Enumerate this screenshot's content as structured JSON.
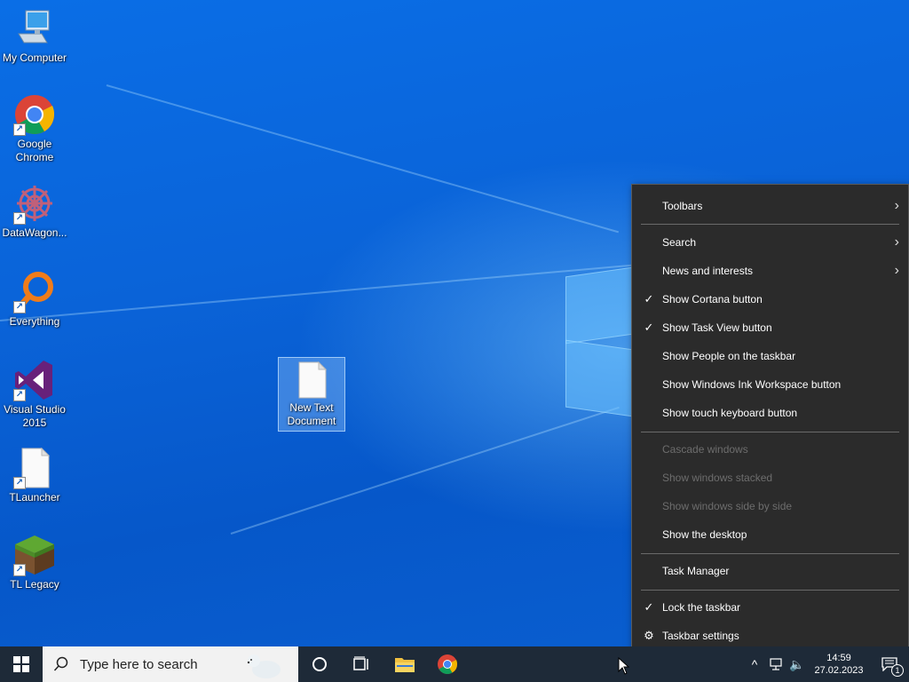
{
  "desktop": {
    "icons": [
      {
        "label": "My Computer",
        "icon": "computer-icon"
      },
      {
        "label": "Google Chrome",
        "icon": "chrome-icon"
      },
      {
        "label": "DataWagon...",
        "icon": "datawagon-icon"
      },
      {
        "label": "Everything",
        "icon": "everything-icon"
      },
      {
        "label": "Visual Studio 2015",
        "icon": "visual-studio-icon"
      },
      {
        "label": "TLauncher",
        "icon": "file-icon"
      },
      {
        "label": "TL Legacy",
        "icon": "minecraft-icon"
      },
      {
        "label": "New Text Document",
        "icon": "text-document-icon"
      }
    ]
  },
  "context_menu": {
    "items": [
      {
        "label": "Toolbars",
        "submenu": true
      },
      {
        "label": "Search",
        "submenu": true
      },
      {
        "label": "News and interests",
        "submenu": true
      },
      {
        "label": "Show Cortana button",
        "checked": true
      },
      {
        "label": "Show Task View button",
        "checked": true
      },
      {
        "label": "Show People on the taskbar"
      },
      {
        "label": "Show Windows Ink Workspace button"
      },
      {
        "label": "Show touch keyboard button"
      },
      {
        "label": "Cascade windows",
        "disabled": true
      },
      {
        "label": "Show windows stacked",
        "disabled": true
      },
      {
        "label": "Show windows side by side",
        "disabled": true
      },
      {
        "label": "Show the desktop"
      },
      {
        "label": "Task Manager"
      },
      {
        "label": "Lock the taskbar",
        "checked": true
      },
      {
        "label": "Taskbar settings",
        "icon": "gear-icon"
      }
    ]
  },
  "taskbar": {
    "search_placeholder": "Type here to search",
    "time": "14:59",
    "date": "27.02.2023",
    "notification_count": "1"
  },
  "colors": {
    "taskbar_bg": "#1e2a38",
    "menu_bg": "#2b2b2b",
    "accent": "#0a6ee6"
  }
}
